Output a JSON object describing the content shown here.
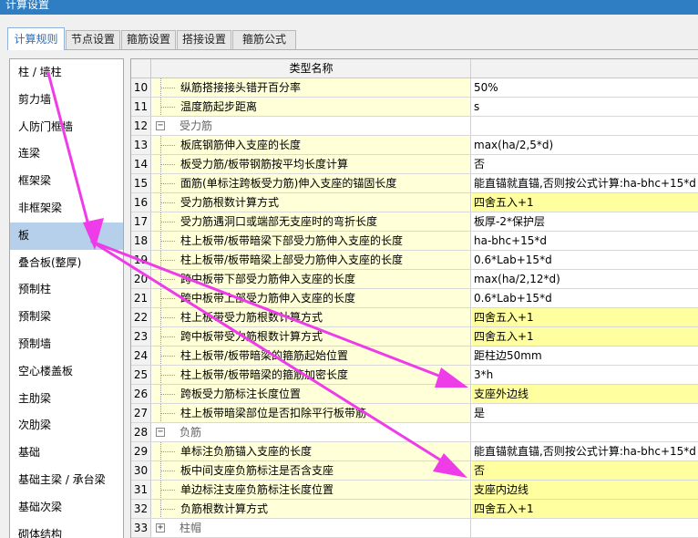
{
  "window": {
    "title": "计算设置"
  },
  "tabs": [
    {
      "label": "计算规则",
      "active": true
    },
    {
      "label": "节点设置",
      "active": false
    },
    {
      "label": "箍筋设置",
      "active": false
    },
    {
      "label": "搭接设置",
      "active": false
    },
    {
      "label": "箍筋公式",
      "active": false
    }
  ],
  "sidebar": {
    "selected": "板",
    "items": [
      "柱 / 墙柱",
      "剪力墙",
      "人防门框墙",
      "连梁",
      "框架梁",
      "非框架梁",
      "板",
      "叠合板(整厚)",
      "预制柱",
      "预制梁",
      "预制墙",
      "空心楼盖板",
      "主肋梁",
      "次肋梁",
      "基础",
      "基础主梁 / 承台梁",
      "基础次梁",
      "砌体结构"
    ]
  },
  "grid": {
    "header": {
      "name": "类型名称",
      "value": ""
    },
    "rows": [
      {
        "num": "10",
        "name": "纵筋搭接接头错开百分率",
        "value": "50%",
        "highlight": false,
        "group": false
      },
      {
        "num": "11",
        "name": "温度筋起步距离",
        "value": "s",
        "highlight": false,
        "group": false
      },
      {
        "num": "12",
        "name": "受力筋",
        "value": "",
        "highlight": false,
        "group": true,
        "toggle": "−"
      },
      {
        "num": "13",
        "name": "板底钢筋伸入支座的长度",
        "value": "max(ha/2,5*d)",
        "highlight": false,
        "group": false
      },
      {
        "num": "14",
        "name": "板受力筋/板带钢筋按平均长度计算",
        "value": "否",
        "highlight": false,
        "group": false
      },
      {
        "num": "15",
        "name": "面筋(单标注跨板受力筋)伸入支座的锚固长度",
        "value": "能直锚就直锚,否则按公式计算:ha-bhc+15*d",
        "highlight": false,
        "group": false
      },
      {
        "num": "16",
        "name": "受力筋根数计算方式",
        "value": "四舍五入+1",
        "highlight": true,
        "group": false
      },
      {
        "num": "17",
        "name": "受力筋遇洞口或端部无支座时的弯折长度",
        "value": "板厚-2*保护层",
        "highlight": false,
        "group": false
      },
      {
        "num": "18",
        "name": "柱上板带/板带暗梁下部受力筋伸入支座的长度",
        "value": "ha-bhc+15*d",
        "highlight": false,
        "group": false
      },
      {
        "num": "19",
        "name": "柱上板带/板带暗梁上部受力筋伸入支座的长度",
        "value": "0.6*Lab+15*d",
        "highlight": false,
        "group": false
      },
      {
        "num": "20",
        "name": "跨中板带下部受力筋伸入支座的长度",
        "value": "max(ha/2,12*d)",
        "highlight": false,
        "group": false
      },
      {
        "num": "21",
        "name": "跨中板带上部受力筋伸入支座的长度",
        "value": "0.6*Lab+15*d",
        "highlight": false,
        "group": false
      },
      {
        "num": "22",
        "name": "柱上板带受力筋根数计算方式",
        "value": "四舍五入+1",
        "highlight": true,
        "group": false
      },
      {
        "num": "23",
        "name": "跨中板带受力筋根数计算方式",
        "value": "四舍五入+1",
        "highlight": true,
        "group": false
      },
      {
        "num": "24",
        "name": "柱上板带/板带暗梁的箍筋起始位置",
        "value": "距柱边50mm",
        "highlight": false,
        "group": false
      },
      {
        "num": "25",
        "name": "柱上板带/板带暗梁的箍筋加密长度",
        "value": "3*h",
        "highlight": false,
        "group": false
      },
      {
        "num": "26",
        "name": "跨板受力筋标注长度位置",
        "value": "支座外边线",
        "highlight": true,
        "group": false
      },
      {
        "num": "27",
        "name": "柱上板带暗梁部位是否扣除平行板带筋",
        "value": "是",
        "highlight": false,
        "group": false
      },
      {
        "num": "28",
        "name": "负筋",
        "value": "",
        "highlight": false,
        "group": true,
        "toggle": "−"
      },
      {
        "num": "29",
        "name": "单标注负筋锚入支座的长度",
        "value": "能直锚就直锚,否则按公式计算:ha-bhc+15*d",
        "highlight": false,
        "group": false
      },
      {
        "num": "30",
        "name": "板中间支座负筋标注是否含支座",
        "value": "否",
        "highlight": true,
        "group": false
      },
      {
        "num": "31",
        "name": "单边标注支座负筋标注长度位置",
        "value": "支座内边线",
        "highlight": true,
        "group": false
      },
      {
        "num": "32",
        "name": "负筋根数计算方式",
        "value": "四舍五入+1",
        "highlight": true,
        "group": false
      },
      {
        "num": "33",
        "name": "柱帽",
        "value": "",
        "highlight": false,
        "group": true,
        "toggle": "+"
      }
    ]
  },
  "annotation_colors": {
    "arrow": "#ee3ce8"
  }
}
